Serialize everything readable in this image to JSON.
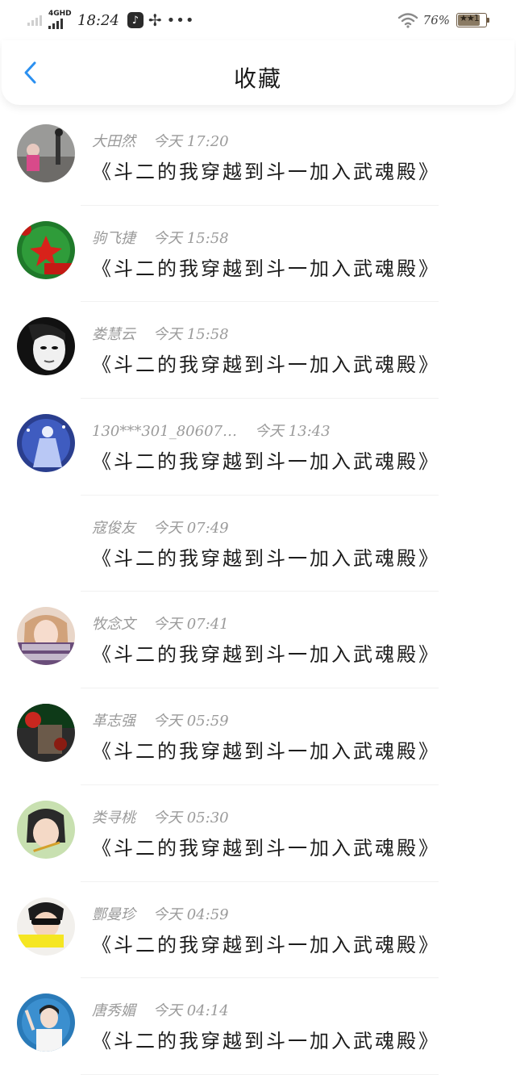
{
  "status_bar": {
    "network": "4GHD",
    "time": "18:24",
    "battery_percent": "76%",
    "icons": [
      "signal-icon",
      "music-app-icon",
      "pinwheel-icon",
      "more-dots-icon",
      "wifi-icon",
      "battery-icon"
    ]
  },
  "header": {
    "title": "收藏",
    "back_icon": "back-chevron-icon",
    "accent_color": "#2b90f0"
  },
  "items": [
    {
      "name": "大田然",
      "time": "今天 17:20",
      "title": "《斗二的我穿越到斗一加入武魂殿》",
      "has_avatar": true
    },
    {
      "name": "驹飞捷",
      "time": "今天 15:58",
      "title": "《斗二的我穿越到斗一加入武魂殿》",
      "has_avatar": true
    },
    {
      "name": "娄慧云",
      "time": "今天 15:58",
      "title": "《斗二的我穿越到斗一加入武魂殿》",
      "has_avatar": true
    },
    {
      "name": "130***301_80607…",
      "time": "今天 13:43",
      "title": "《斗二的我穿越到斗一加入武魂殿》",
      "has_avatar": true
    },
    {
      "name": "寇俊友",
      "time": "今天 07:49",
      "title": "《斗二的我穿越到斗一加入武魂殿》",
      "has_avatar": false
    },
    {
      "name": "牧念文",
      "time": "今天 07:41",
      "title": "《斗二的我穿越到斗一加入武魂殿》",
      "has_avatar": true
    },
    {
      "name": "革志强",
      "time": "今天 05:59",
      "title": "《斗二的我穿越到斗一加入武魂殿》",
      "has_avatar": true
    },
    {
      "name": "类寻桃",
      "time": "今天 05:30",
      "title": "《斗二的我穿越到斗一加入武魂殿》",
      "has_avatar": true
    },
    {
      "name": "酆曼珍",
      "time": "今天 04:59",
      "title": "《斗二的我穿越到斗一加入武魂殿》",
      "has_avatar": true
    },
    {
      "name": "唐秀媚",
      "time": "今天 04:14",
      "title": "《斗二的我穿越到斗一加入武魂殿》",
      "has_avatar": true
    }
  ]
}
